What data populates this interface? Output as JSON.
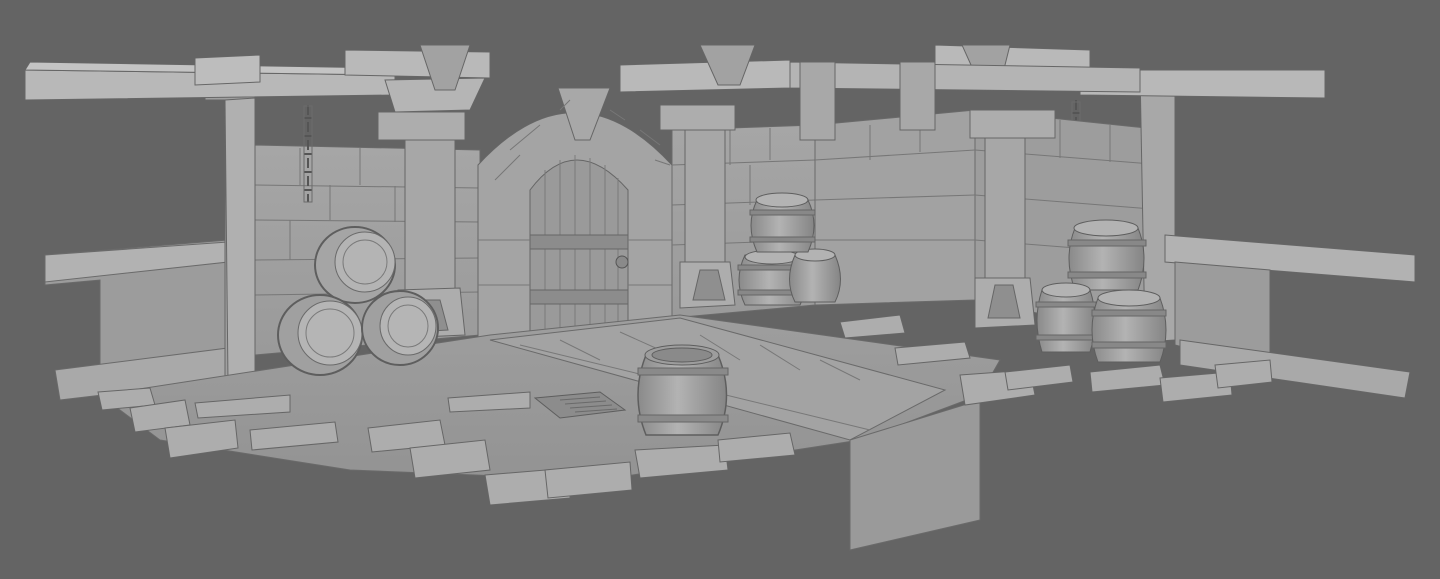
{
  "viewport": {
    "background_color": "#646464",
    "model_color_light": "#a8a8a8",
    "model_color_mid": "#969696",
    "model_color_dark": "#7a7a7a",
    "edge_color": "#5a5a5a",
    "render_mode": "clay-shaded"
  },
  "scene": {
    "objects": [
      "stone-wall",
      "wooden-beam",
      "stone-pillar",
      "arched-door",
      "hanging-chain",
      "barrel",
      "floor-tile",
      "floor-grate",
      "loose-plank"
    ],
    "barrel_count": 11,
    "chain_count": 2,
    "pillar_count": 4
  }
}
